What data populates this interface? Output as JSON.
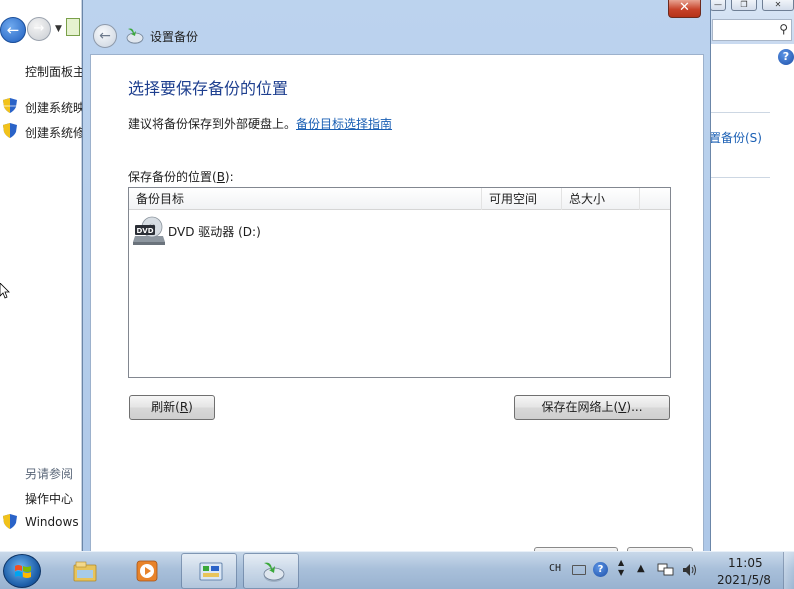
{
  "background_window": {
    "sidebar": {
      "home_link": "控制面板主",
      "links": [
        "创建系统映",
        "创建系统修"
      ],
      "see_also": "另请参阅",
      "see_also_links": [
        "操作中心",
        "Windows"
      ]
    },
    "right_link": "置备份(S)"
  },
  "dialog": {
    "title": "设置备份",
    "close_label": "✕",
    "heading": "选择要保存备份的位置",
    "hint": "建议将备份保存到外部硬盘上。",
    "hint_link": "备份目标选择指南",
    "list_label_pre": "保存备份的位置(",
    "list_label_key": "B",
    "list_label_post": "):",
    "columns": [
      "备份目标",
      "可用空间",
      "总大小"
    ],
    "rows": [
      {
        "name": "DVD 驱动器 (D:)",
        "free": "",
        "total": ""
      }
    ],
    "refresh_pre": "刷新(",
    "refresh_key": "R",
    "refresh_post": ")",
    "network_pre": "保存在网络上(",
    "network_key": "V",
    "network_post": ")..."
  },
  "taskbar": {
    "lang": "CH",
    "clock_time": "11:05",
    "clock_date": "2021/5/8"
  },
  "colors": {
    "heading": "#1e3f8f",
    "link": "#1a5fb4",
    "frame": "#bcd3ee",
    "close": "#c7432a"
  },
  "icons": [
    "back-arrow-icon",
    "backup-icon",
    "dvd-drive-icon",
    "shield-icon",
    "help-icon",
    "windows-start-icon",
    "file-explorer-icon",
    "media-player-icon",
    "control-panel-icon",
    "network-icon",
    "volume-icon"
  ]
}
